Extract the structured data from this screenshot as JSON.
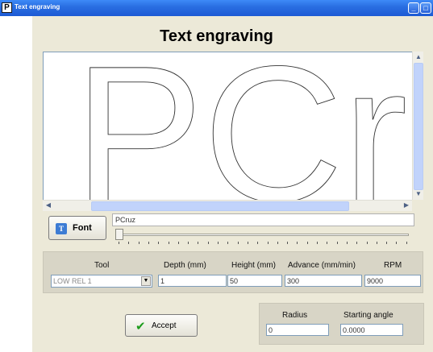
{
  "window": {
    "title": "Text engraving",
    "app_icon_letter": "P"
  },
  "heading": "Text engraving",
  "preview": {
    "text": "PCruz"
  },
  "font_button": {
    "label": "Font",
    "icon_letter": "T"
  },
  "text_input": {
    "value": "PCruz"
  },
  "size_slider": {
    "position": 0.0
  },
  "params": {
    "tool": {
      "label": "Tool",
      "value": "LOW REL 1"
    },
    "depth": {
      "label": "Depth (mm)",
      "value": "1"
    },
    "height": {
      "label": "Height (mm)",
      "value": "50"
    },
    "advance": {
      "label": "Advance (mm/min)",
      "value": "300"
    },
    "rpm": {
      "label": "RPM",
      "value": "9000"
    }
  },
  "radius": {
    "label": "Radius",
    "value": "0"
  },
  "starting_angle": {
    "label": "Starting angle",
    "value": "0.0000"
  },
  "accept_button": {
    "label": "Accept"
  },
  "icons": {
    "accept": "checkmark-icon",
    "font": "font-icon"
  },
  "colors": {
    "titlebar": "#2a6fe2",
    "panel": "#d8d5c6",
    "window_bg": "#ece9d8",
    "accept_check": "#1d9c1d"
  }
}
